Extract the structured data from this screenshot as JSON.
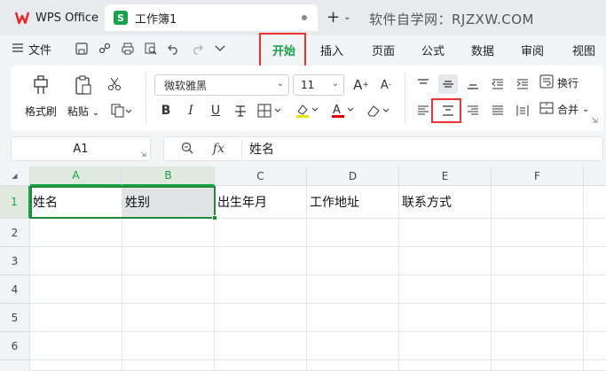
{
  "titlebar": {
    "app_tab": "WPS Office",
    "doc_tab": "工作簿1",
    "doc_badge": "S",
    "watermark": "软件自学网：RJZXW.COM"
  },
  "menubar": {
    "file": "文件",
    "tabs": [
      {
        "label": "开始",
        "active": true
      },
      {
        "label": "插入",
        "active": false
      },
      {
        "label": "页面",
        "active": false
      },
      {
        "label": "公式",
        "active": false
      },
      {
        "label": "数据",
        "active": false
      },
      {
        "label": "审阅",
        "active": false
      },
      {
        "label": "视图",
        "active": false
      }
    ]
  },
  "ribbon": {
    "format_painter": "格式刷",
    "paste": "粘贴",
    "font_name": "微软雅黑",
    "font_size": "11",
    "wrap_text": "换行",
    "merge": "合并"
  },
  "formula": {
    "cell_ref": "A1",
    "fx": "fx",
    "value": "姓名"
  },
  "grid": {
    "columns": [
      "A",
      "B",
      "C",
      "D",
      "E",
      "F"
    ],
    "rows": [
      "1",
      "2",
      "3",
      "4",
      "5",
      "6"
    ],
    "row1": [
      "姓名",
      "姓别",
      "出生年月",
      "工作地址",
      "联系方式",
      ""
    ]
  },
  "colors": {
    "accent": "#17a34a",
    "highlight": "#e33333",
    "selection": "#1f8a38"
  }
}
